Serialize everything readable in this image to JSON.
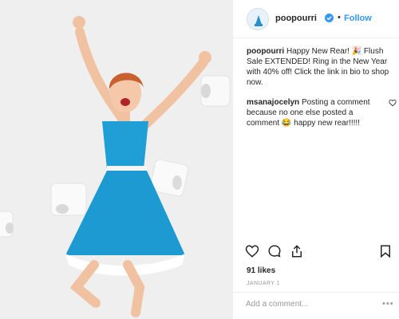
{
  "post": {
    "username": "poopourri",
    "separator": "•",
    "follow_label": "Follow",
    "caption_user": "poopourri",
    "caption_text": "Happy New Rear! 🎉 Flush Sale EXTENDED! Ring in the New Year with 40% off! Click the link in bio to shop now.",
    "comment_user": "msanajocelyn",
    "comment_text": "Posting a comment because no one else posted a comment 😂 happy new rear!!!!!",
    "likes": "91 likes",
    "date": "JANUARY 1",
    "add_comment_placeholder": "Add a comment...",
    "more_label": "•••"
  },
  "icons": {
    "like": "heart-icon",
    "comment": "comment-icon",
    "share": "share-icon",
    "save": "bookmark-icon",
    "verified": "verified-badge-icon",
    "comment_like": "heart-icon"
  },
  "colors": {
    "link_blue": "#3897f0",
    "dress_blue": "#1f9fd6",
    "text": "#262626",
    "muted": "#999999"
  }
}
